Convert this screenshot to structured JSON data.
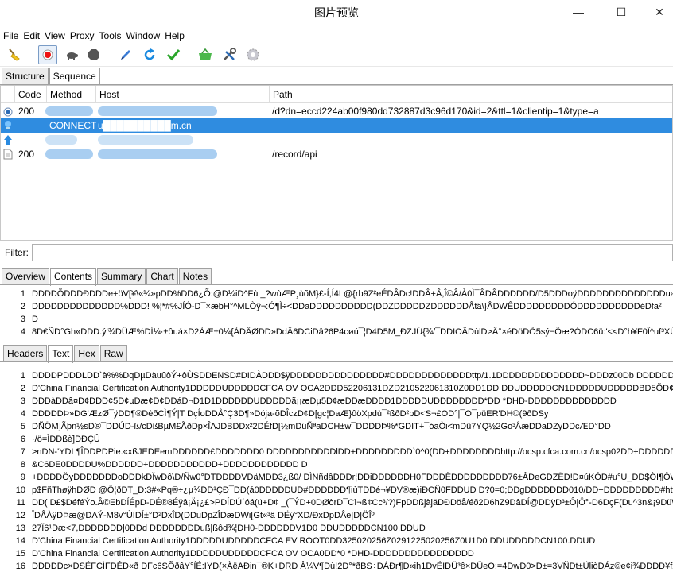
{
  "window": {
    "title": "图片预览",
    "minimize": "—",
    "maximize": "☐",
    "close": "✕"
  },
  "menu": [
    "File",
    "Edit",
    "View",
    "Proxy",
    "Tools",
    "Window",
    "Help"
  ],
  "toolbar": {
    "icons": [
      "broom-icon",
      "record-icon",
      "turtle-icon",
      "stop-icon",
      "pen-icon",
      "refresh-icon",
      "check-icon",
      "basket-icon",
      "tools-icon",
      "settings-icon"
    ]
  },
  "top_tabs": {
    "structure": "Structure",
    "sequence": "Sequence"
  },
  "grid": {
    "columns": {
      "code": "Code",
      "method": "Method",
      "host": "Host",
      "path": "Path"
    },
    "rows": [
      {
        "icon": "circle",
        "code": "200",
        "method": "",
        "host": "",
        "path": "/d?dn=eccd224ab00f980dd732887d3c96d170&id=2&ttl=1&clientip=1&type=a"
      },
      {
        "icon": "lightbulb",
        "code": "",
        "method": "CONNECT",
        "host": "u██████████m.cn",
        "path": ""
      },
      {
        "icon": "arrow-up",
        "code": "",
        "method": "",
        "host": "",
        "path": ""
      },
      {
        "icon": "document",
        "code": "200",
        "method": "",
        "host": "",
        "path": "/record/api"
      }
    ]
  },
  "filter": {
    "label": "Filter:",
    "value": ""
  },
  "request_tabs": {
    "overview": "Overview",
    "contents": "Contents",
    "summary": "Summary",
    "chart": "Chart",
    "notes": "Notes"
  },
  "request_lines": [
    {
      "n": "1",
      "t": "DDDDÕDDDÐDDDe+öV[¥\\«¼»pDD%DD6¿Õ:@D¼iD^Fù _?wùÆP¸ùõM}£-Í,Í4L@{rb9Z²eÉDÂDc!DDÂ+Â,Î©Â/À0Ì¯ÂDÂDDDDDD/D5DDDoÿDDDDDDDDDDDDDDuat-dcm"
    },
    {
      "n": "2",
      "t": "DDDDDDDDDDDDDD%DDD! %¦*#%JÍÓ-D¯×æbH°^MLÒÿ¬:Ó¶Ì÷<DDaDDDDDDDDDD(DDZDDDDDZDDDDDDÂtâ\\}ÂDWÊDDDDDDDDDÓDDDDDDDDDDéDfa²"
    },
    {
      "n": "3",
      "t": "D"
    },
    {
      "n": "4",
      "t": "8D€ÑD°Gh«DDD.ý'¾DÛÆ%DÍ¼·±ôuá×D2ÀÆ±0¼{ÀDÂØDD»DdÂ6DCiDâ?6P4cøú¯¦D4D5M_ÐZJÚ{¾/¯DDIOÂDùlD>Â°×éDöDÕ5sý¬Õæ?ÓDC6ü:'<<D°h¥F0Î^uf³XÚP¦"
    }
  ],
  "response_tabs": {
    "headers": "Headers",
    "text": "Text",
    "hex": "Hex",
    "raw": "Raw"
  },
  "response_lines": [
    {
      "n": "1",
      "t": "DDDDPDDDLDD`à%%DqDµDàuûòÝ+òÙSDDENSD#DIDÀDDD$ÿDDDDDDDDDDDDDDD#DDDDDDDDDDDDDttp/1.1DDDDDDDDDDDDDD~DDDz00Db DDDDDDD DD¯Fé2¤DCDHD7D"
    },
    {
      "n": "2",
      "t": "D'China Financial Certification Authority1DDDDDUDDDDDCFCA OV OCA2DDD52206131DZD210522061310Z0DD1DD DDUDDDDDCN1DDDDDUDDDDDBD5ÕD¢D01DDUDDDD"
    },
    {
      "n": "3",
      "t": "DDDàDDâ¤D¢DDD¢5D¢µDæ¢D¢DDáD¬D1D1DDDDDDUDDDDDã¡¡æDµ5D¢æDDæDDDD1DDDDDUDDDDDDDD*DD  *DHD-DDDDDDDDDDDDDD"
    },
    {
      "n": "4",
      "t": "DDDDDÞ»DG'ÆzØ¯ÿDD¶®DèðCÌ¶Ý|T DçÍoDDÅ°Ç3D¶»Dója-õDÎczD¢D[gc¦DaÆ}ôöXpdù¯²ßðD²pD<S¬£OD°|¯O¯püER'DH©(9ðDSy"
    },
    {
      "n": "5",
      "t": "DÑÖM]Ãþn½sD®¯DDÚD-ß/cDßBµM£ÃðDp×ÎAJDBDDx²2DÉfD[½mDûÑªaDCH±w¯DDDDÞ%*GDIT+¯óaÒi<mDü7YQ½2Go³ÅæDDaDZyDDcÆD°DD"
    },
    {
      "n": "6",
      "t": "·/ö=ÌDDßè]DÐÇÛ"
    },
    {
      "n": "7",
      "t": ">nDN-'YDL¶ÎDDPDPie.«xßJEDEemDDDDDD£DDDDDDD0 DDDDDDDDDDDlDD+DDDDDDDDD`0^0(DD+DDDDDDDDhttp://ocsp.cfca.com.cn/ocsp02DD+DDDDDDDD&http://g"
    },
    {
      "n": "8",
      "t": "&C6DE0DDDDU%DDDDDD+DDDDDDDDDDD+DDDDDDDDDDDD D"
    },
    {
      "n": "9",
      "t": "+DDDDÖyDDDDDDDoDDDkDÏwDô\\D/Ñw0°DTDDDDVDäMDD3¿ß0/ DÌNñdâDDDr¦DDiDDDDDDH0FDDDÈDDDDDDDDD76±ÂDeGDZËD!D¤úKÓD#u°U_DD$ÒI¶ÔW°øùlUè¦æµ$¶U"
    },
    {
      "n": "10",
      "t": "p$FñThøÿhDØD @Ö¦ðDT_D:3#«Pq®÷¿µ¾DD¹ÇÐ¯DD(á0DDDDDUD#DDDDDD¶iùTDDé¬¥DV®æ)iÐCÑ0FDDUD D?0=0;DDgDDDDDDD010/DD+DDDDDDDDD#http://www.cfca."
    },
    {
      "n": "11",
      "t": "DD( D£$DéféÝo.Â©EbDÍÉpD-DÉ®8Éÿâ¡Ä¡¿£>PDÍDÚ´óá(ü+D¢ _(¯ÝD+0DØòrD¯Cì¬ß¢Cc³/?)FpDDßjàjäDÐDöå/éð2D6hZ9DâDÍ@DDÿD³±Ô|Ô°-D6DçF(Du^3n&¡9DüW³D"
    },
    {
      "n": "12",
      "t": "ÏDÂÀÿDÞæ@DAÝ-M8v°ÙIDÍ±°D²DxÎD(DDuDpZÎDæDWi[Gt«³â DËý°XD/ÐxDpDÂe|D|ÖÎº"
    },
    {
      "n": "13",
      "t": "27Ï6¹Dæ<7,DDDDDDD|0DDd DDDDDDDDuß|ßôd¾¦DH0-DDDDDDV1D0    DDUDDDDDCN100.DDUD"
    },
    {
      "n": "14",
      "t": "D'China Financial Certification Authority1DDDDDUDDDDDCFCA EV ROOT0DD325020256Z0291225020256Z0U1D0      DDUDDDDDCN100.DDUD"
    },
    {
      "n": "15",
      "t": "D'China Financial Certification Authority1DDDDDUDDDDDCFCA OV OCA0DD*0  *DHD-DDDDDDDDDDDDDDDD"
    },
    {
      "n": "16",
      "t": "DDDDDc×DSÉFCÌFDÊD«ð DFc6SÕðâY°ÍÉ:IYD(×ÀëAÐin¯®K+DRD Â¼V¶Dù!2D°*ðBS÷DÁÐr¶D«ih1DvÉIDÜ³ê×DÜeO;=4DwD0>D±=3VÑDt±ÜliòDÁz©e¢i¾DDDD¥fX"
    }
  ]
}
